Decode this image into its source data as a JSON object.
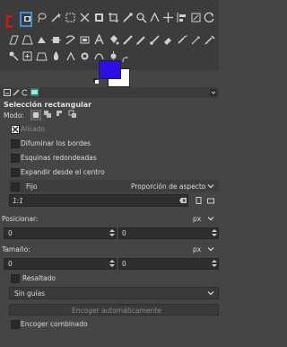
{
  "tool_options": {
    "title": "Selección rectangular",
    "mode_label": "Modo:",
    "antialias_label": "Alisado",
    "feather_label": "Difuminar los bordes",
    "rounded_label": "Esquinas redondeadas",
    "expand_label": "Expandir desde el centro",
    "fixed_label": "Fijo",
    "fixed_dropdown": "Proporción de aspecto",
    "ratio_value": "1:1",
    "position_label": "Posicionar:",
    "position_unit": "px",
    "position_x": "0",
    "position_y": "0",
    "size_label": "Tamaño:",
    "size_unit": "px",
    "size_w": "0",
    "size_h": "0",
    "highlight_label": "Resaltado",
    "guides_value": "Sin guías",
    "autoshrink_label": "Encoger automáticamente",
    "shrink_merged_label": "Encoger combinado"
  },
  "colors": {
    "foreground": "#2a0ee4",
    "background": "#ffffff",
    "accent": "#3a8fdb"
  }
}
